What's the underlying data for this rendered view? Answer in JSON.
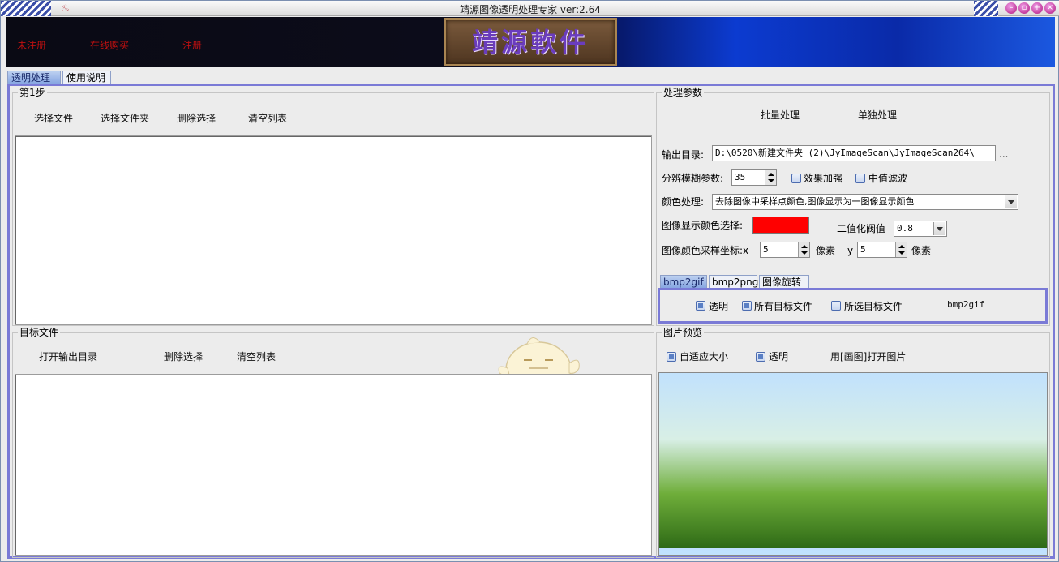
{
  "window": {
    "title": "靖源图像透明处理专家 ver:2.64",
    "icon_name": "app-icon"
  },
  "banner": {
    "links": [
      "未注册",
      "在线购买",
      "注册"
    ],
    "logo_text": "靖源軟件"
  },
  "top_tabs": [
    "透明处理",
    "使用说明"
  ],
  "step1": {
    "title": "第1步",
    "buttons": [
      "选择文件",
      "选择文件夹",
      "删除选择",
      "清空列表"
    ]
  },
  "target": {
    "title": "目标文件",
    "buttons": [
      "打开输出目录",
      "删除选择",
      "清空列表"
    ]
  },
  "params": {
    "title": "处理参数",
    "batch_button": "批量处理",
    "single_button": "单独处理",
    "output_dir_label": "输出目录:",
    "output_dir_value": "D:\\0520\\新建文件夹 (2)\\JyImageScan\\JyImageScan264\\",
    "browse_label": "...",
    "blur_label": "分辨模糊参数:",
    "blur_value": "35",
    "enhance_label": "效果加强",
    "median_label": "中值滤波",
    "color_proc_label": "颜色处理:",
    "color_proc_value": "去除图像中采样点颜色,图像显示为一图像显示颜色",
    "display_color_label": "图像显示颜色选择:",
    "display_color": "#ff0000",
    "threshold_label": "二值化阀值",
    "threshold_value": "0.8",
    "sample_label": "图像颜色采样坐标:x",
    "sample_x": "5",
    "pixel_unit": "像素",
    "y_label": "y",
    "sample_y": "5",
    "pixel_unit2": "像素"
  },
  "sub_tabs": [
    "bmp2gif",
    "bmp2png",
    "图像旋转"
  ],
  "bmp2gif": {
    "opt_transparent": "透明",
    "opt_all": "所有目标文件",
    "opt_selected": "所选目标文件",
    "action": "bmp2gif"
  },
  "preview": {
    "title": "图片预览",
    "fit_label": "自适应大小",
    "transparent_label": "透明",
    "open_paint": "用[画图]打开图片"
  },
  "colors": {
    "accent_frame": "#7a7ad6",
    "banner_link": "#c01010"
  }
}
